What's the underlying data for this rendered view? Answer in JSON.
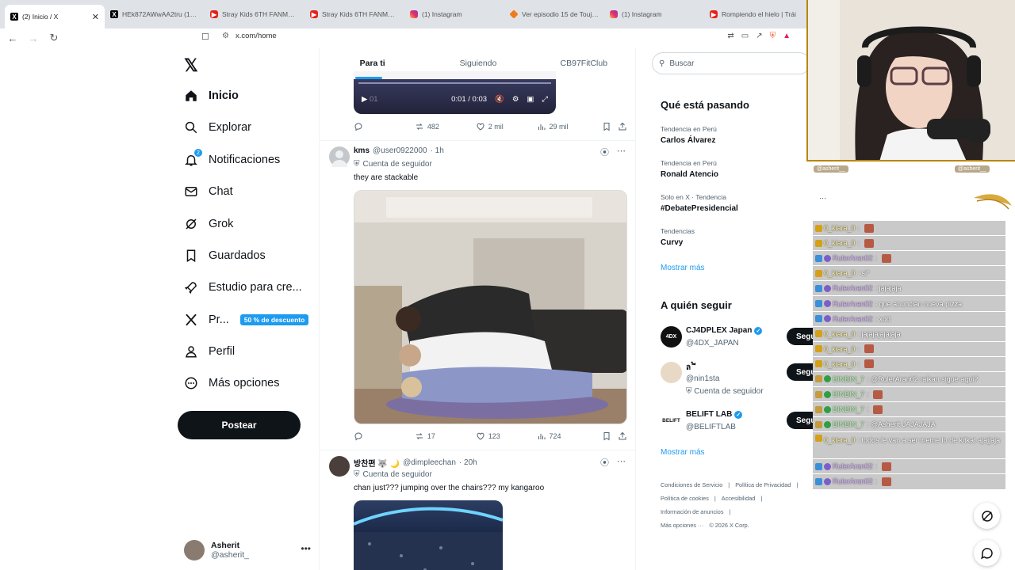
{
  "browser": {
    "tabs": [
      {
        "label": "(2) Inicio / X",
        "icon": "x-logo-icon",
        "active": true
      },
      {
        "label": "HEk872AWwAA2tru (1836",
        "icon": "x-logo-icon"
      },
      {
        "label": "Stray Kids 6TH FANMEETI",
        "icon": "youtube-icon"
      },
      {
        "label": "Stray Kids 6TH FANMEETI",
        "icon": "youtube-icon"
      },
      {
        "label": "(1) Instagram",
        "icon": "instagram-icon"
      },
      {
        "label": "Ver episodio 15 de Toujim",
        "icon": "tojima-icon"
      },
      {
        "label": "(1) Instagram",
        "icon": "instagram-icon"
      },
      {
        "label": "Rompiendo el hielo | Trái",
        "icon": "youtube-icon"
      }
    ],
    "url": "x.com/home"
  },
  "nav": {
    "items": [
      {
        "label": "Inicio",
        "icon": "home-icon"
      },
      {
        "label": "Explorar",
        "icon": "search-icon"
      },
      {
        "label": "Notificaciones",
        "icon": "bell-icon",
        "badge": "2"
      },
      {
        "label": "Chat",
        "icon": "mail-icon"
      },
      {
        "label": "Grok",
        "icon": "grok-icon"
      },
      {
        "label": "Guardados",
        "icon": "bookmark-icon"
      },
      {
        "label": "Estudio para cre...",
        "icon": "rocket-icon"
      },
      {
        "label": "Pr...",
        "icon": "x-logo-icon",
        "promo": "50 % de descuento"
      },
      {
        "label": "Perfil",
        "icon": "person-icon"
      },
      {
        "label": "Más opciones",
        "icon": "more-circle-icon"
      }
    ],
    "post_button": "Postear",
    "account": {
      "name": "Asherit",
      "handle": "@asherit_"
    }
  },
  "feed": {
    "tabs": [
      "Para ti",
      "Siguiendo",
      "CB97FitClub"
    ],
    "video_time": "0:01 / 0:03",
    "video_left": "01",
    "tweet0_stats": {
      "retweets": "482",
      "likes": "2 mil",
      "views": "29 mil"
    },
    "tweet1": {
      "name": "kms",
      "handle": "@user0922000",
      "time": "· 1h",
      "social": "Cuenta de seguidor",
      "text": "they are stackable",
      "retweets": "17",
      "likes": "123",
      "views": "724"
    },
    "tweet2": {
      "name": "방찬편 🐺 🌙",
      "handle": "@dimpleechan",
      "time": "· 20h",
      "social": "Cuenta de seguidor",
      "text": "chan just??? jumping over the chairs??? my kangaroo"
    }
  },
  "sidebar": {
    "search_placeholder": "Buscar",
    "trends_title": "Qué está pasando",
    "trends": [
      {
        "context": "Tendencia en Perú",
        "name": "Carlos Álvarez"
      },
      {
        "context": "Tendencia en Perú",
        "name": "Ronald Atencio"
      },
      {
        "context": "Solo en X · Tendencia",
        "name": "#DebatePresidencial"
      },
      {
        "context": "Tendencias",
        "name": "Curvy"
      }
    ],
    "show_more": "Mostrar más",
    "follow_title": "A quién seguir",
    "follow": [
      {
        "name": "CJ4DPLEX Japan",
        "handle": "@4DX_JAPAN",
        "verified": true,
        "avatar_text": "4DX"
      },
      {
        "name": "ล ๋ ี",
        "handle": "@nin1sta",
        "sub": "Cuenta de seguidor",
        "verified": false,
        "avatar_text": ""
      },
      {
        "name": "BELIFT LAB",
        "handle": "@BELIFTLAB",
        "verified": true,
        "avatar_text": "BELIFT"
      }
    ],
    "follow_button": "Segui",
    "follow_more": "Mostrar más",
    "footer": [
      "Condiciones de Servicio",
      "|",
      "Política de Privacidad",
      "|",
      "Política de cookies",
      "|",
      "Accesibilidad",
      "|",
      "Información de anuncios",
      "|",
      "Más opciones ···",
      "© 2026 X Corp."
    ]
  },
  "stream": {
    "top_users": [
      "@asherit__",
      "@asherit__"
    ],
    "chat": [
      {
        "user": "0_kiara_0",
        "msg": "",
        "color": "gold",
        "emote": true
      },
      {
        "user": "0_kiara_0",
        "msg": "",
        "color": "gold",
        "emote": true
      },
      {
        "user": "RulerAran02",
        "msg": "",
        "color": "purple",
        "emote": true
      },
      {
        "user": "0_kiara_0",
        "msg": "si*",
        "color": "gold"
      },
      {
        "user": "RulerAran02",
        "msg": "jajajaja",
        "color": "purple"
      },
      {
        "user": "RulerAran02",
        "msg": "que anuncian nueva pizza",
        "color": "purple"
      },
      {
        "user": "RulerAran02",
        "msg": "xdd",
        "color": "purple"
      },
      {
        "user": "0_kiara_0",
        "msg": "jajajajajajaja",
        "color": "gold"
      },
      {
        "user": "0_kiara_0",
        "msg": "",
        "color": "gold",
        "emote": true
      },
      {
        "user": "0_kiara_0",
        "msg": "",
        "color": "gold",
        "emote": true
      },
      {
        "user": "BINBIN_7",
        "msg": "@RulerAran02 raikan sigue aqui?",
        "color": "green"
      },
      {
        "user": "BINBIN_7",
        "msg": "",
        "color": "green",
        "emote": true
      },
      {
        "user": "BINBIN_7",
        "msg": "",
        "color": "green",
        "emote": true
      },
      {
        "user": "BINBIN_7",
        "msg": "@Asherit JAJAJAJA",
        "color": "green"
      },
      {
        "user": "0_kiara_0",
        "msg": "todos le van a ser meme lo de kitkat ajajjaja",
        "color": "gold",
        "tall": true
      },
      {
        "user": "RulerAran02",
        "msg": "",
        "color": "purple",
        "emote": true
      },
      {
        "user": "RulerAran02",
        "msg": "",
        "color": "purple",
        "emote": true
      }
    ]
  }
}
